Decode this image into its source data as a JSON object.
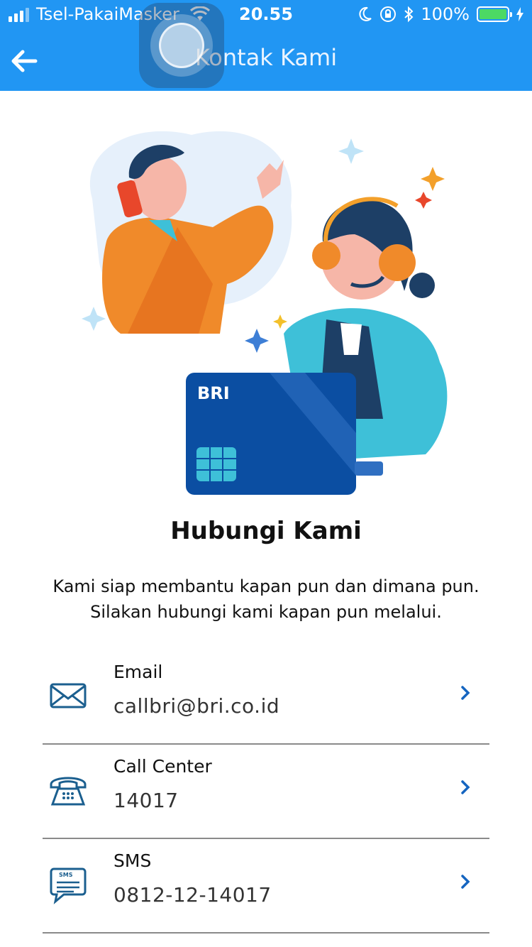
{
  "status_bar": {
    "carrier": "Tsel-PakaiMasker",
    "time": "20.55",
    "battery": "100%"
  },
  "header": {
    "title": "Kontak Kami"
  },
  "illustration": {
    "card_brand": "BRI"
  },
  "main": {
    "heading": "Hubungi Kami",
    "description_line1": "Kami siap membantu kapan pun dan dimana pun.",
    "description_line2": "Silakan hubungi kami kapan pun melalui."
  },
  "contacts": [
    {
      "icon": "email-icon",
      "label": "Email",
      "value": "callbri@bri.co.id"
    },
    {
      "icon": "phone-icon",
      "label": "Call Center",
      "value": "14017"
    },
    {
      "icon": "sms-icon",
      "label": "SMS",
      "value": "0812-12-14017"
    }
  ],
  "colors": {
    "header": "#2196f3",
    "accent": "#1565c0",
    "icon": "#1b5f8f"
  }
}
